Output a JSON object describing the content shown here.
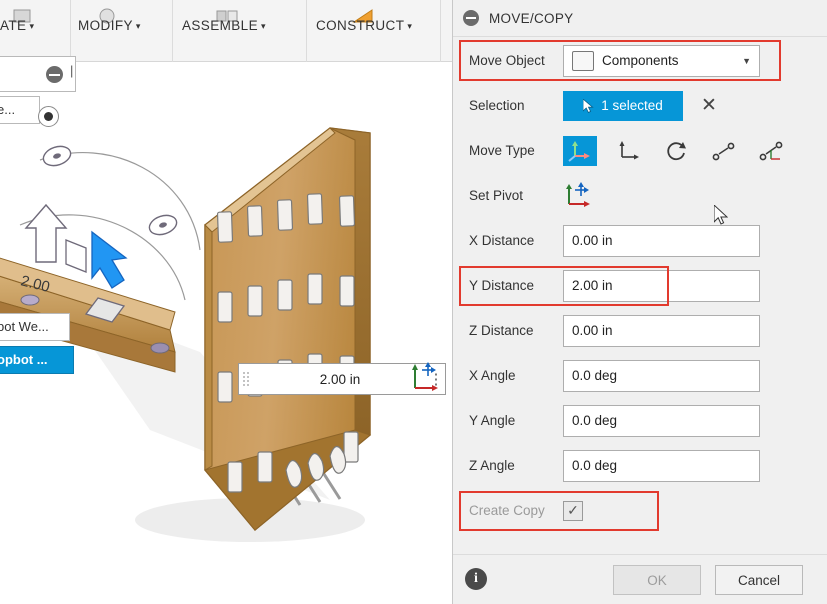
{
  "toolbar": {
    "items": [
      {
        "label": "ATE",
        "caret": "▾"
      },
      {
        "label": "MODIFY",
        "caret": "▾"
      },
      {
        "label": "ASSEMBLE",
        "caret": "▾"
      },
      {
        "label": "CONSTRUCT",
        "caret": "▾"
      }
    ]
  },
  "canvas": {
    "browser_chips": [
      {
        "label": "e...",
        "selected": false
      },
      {
        "label": "bot We...",
        "selected": false
      },
      {
        "label": "opbot ...",
        "selected": true
      }
    ],
    "dimension_label": "2.00",
    "drag_value": "2.00 in",
    "drag_dots": "⋮"
  },
  "dialog": {
    "title": "MOVE/COPY",
    "rows": [
      {
        "label": "Move Object",
        "value": "Components",
        "type": "select",
        "highlight": true
      },
      {
        "label": "Selection",
        "value": "1 selected",
        "type": "selection",
        "clear": "✕"
      },
      {
        "label": "Move Type",
        "type": "icons"
      },
      {
        "label": "Set Pivot",
        "type": "pivot"
      },
      {
        "label": "X Distance",
        "value": "0.00 in",
        "type": "text"
      },
      {
        "label": "Y Distance",
        "value": "2.00 in",
        "type": "text",
        "highlight": true
      },
      {
        "label": "Z Distance",
        "value": "0.00 in",
        "type": "text"
      },
      {
        "label": "X Angle",
        "value": "0.0 deg",
        "type": "text"
      },
      {
        "label": "Y Angle",
        "value": "0.0 deg",
        "type": "text"
      },
      {
        "label": "Z Angle",
        "value": "0.0 deg",
        "type": "text"
      },
      {
        "label": "Create Copy",
        "value": "✓",
        "type": "checkbox",
        "highlight": true
      }
    ],
    "buttons": {
      "ok": "OK",
      "cancel": "Cancel"
    },
    "info": "i"
  },
  "colors": {
    "accent": "#0696d7",
    "highlight": "#e23a2e",
    "panel": "#f0f0f0",
    "wood": "#c89a5b"
  }
}
